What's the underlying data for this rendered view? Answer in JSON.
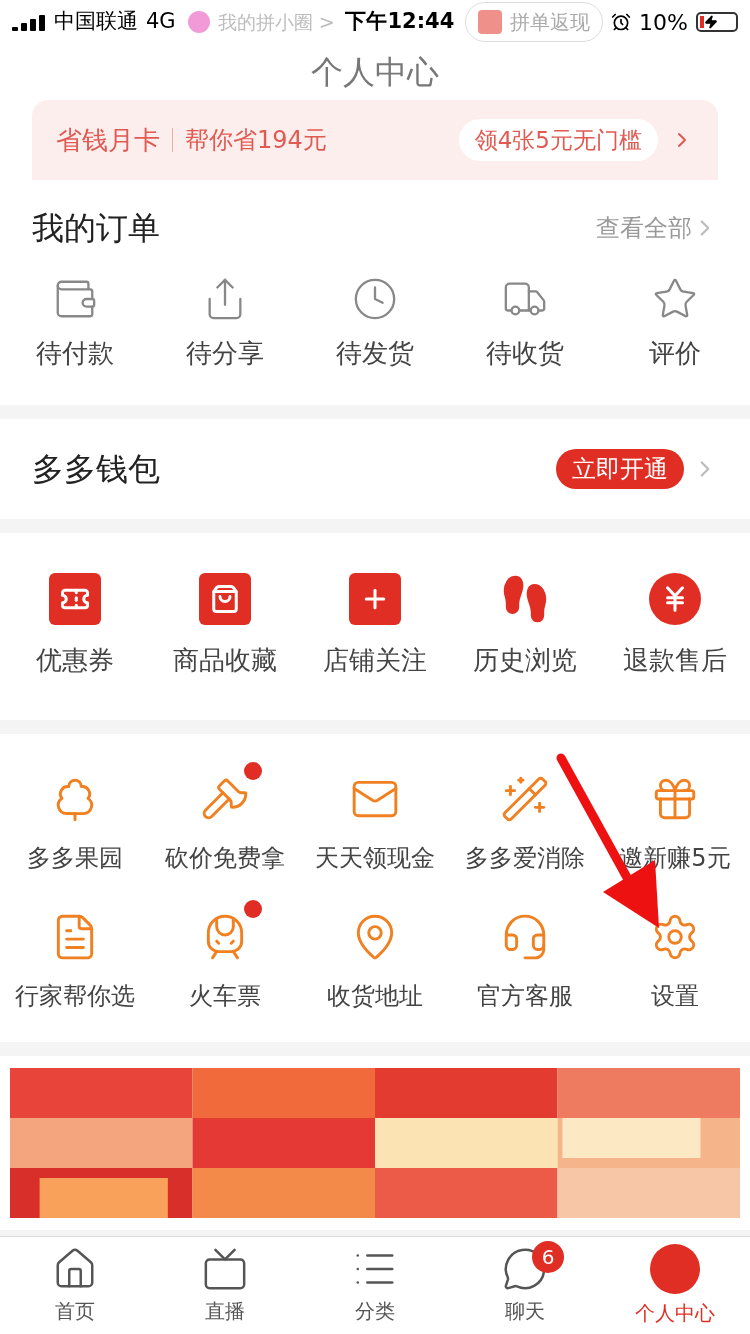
{
  "status_bar": {
    "carrier": "中国联通",
    "network": "4G",
    "time": "下午12:44",
    "battery": "10%"
  },
  "header": {
    "circle_link": "我的拼小圈 >",
    "cashback": "拼单返现",
    "title": "个人中心"
  },
  "card": {
    "name": "省钱月卡",
    "saving": "帮你省194元",
    "offer": "领4张5元无门槛"
  },
  "orders": {
    "title": "我的订单",
    "view_all": "查看全部",
    "items": [
      {
        "label": "待付款"
      },
      {
        "label": "待分享"
      },
      {
        "label": "待发货"
      },
      {
        "label": "待收货"
      },
      {
        "label": "评价"
      }
    ]
  },
  "wallet": {
    "title": "多多钱包",
    "button": "立即开通"
  },
  "tools": [
    {
      "label": "优惠券"
    },
    {
      "label": "商品收藏"
    },
    {
      "label": "店铺关注"
    },
    {
      "label": "历史浏览"
    },
    {
      "label": "退款售后"
    }
  ],
  "services": [
    {
      "label": "多多果园",
      "dot": false
    },
    {
      "label": "砍价免费拿",
      "dot": true
    },
    {
      "label": "天天领现金",
      "dot": false
    },
    {
      "label": "多多爱消除",
      "dot": false
    },
    {
      "label": "邀新赚5元",
      "dot": false
    },
    {
      "label": "行家帮你选",
      "dot": false
    },
    {
      "label": "火车票",
      "dot": true
    },
    {
      "label": "收货地址",
      "dot": false
    },
    {
      "label": "官方客服",
      "dot": false
    },
    {
      "label": "设置",
      "dot": false
    }
  ],
  "tab_bar": [
    {
      "label": "首页",
      "selected": false
    },
    {
      "label": "直播",
      "selected": false
    },
    {
      "label": "分类",
      "selected": false
    },
    {
      "label": "聊天",
      "selected": false,
      "badge": "6"
    },
    {
      "label": "个人中心",
      "selected": true
    }
  ]
}
